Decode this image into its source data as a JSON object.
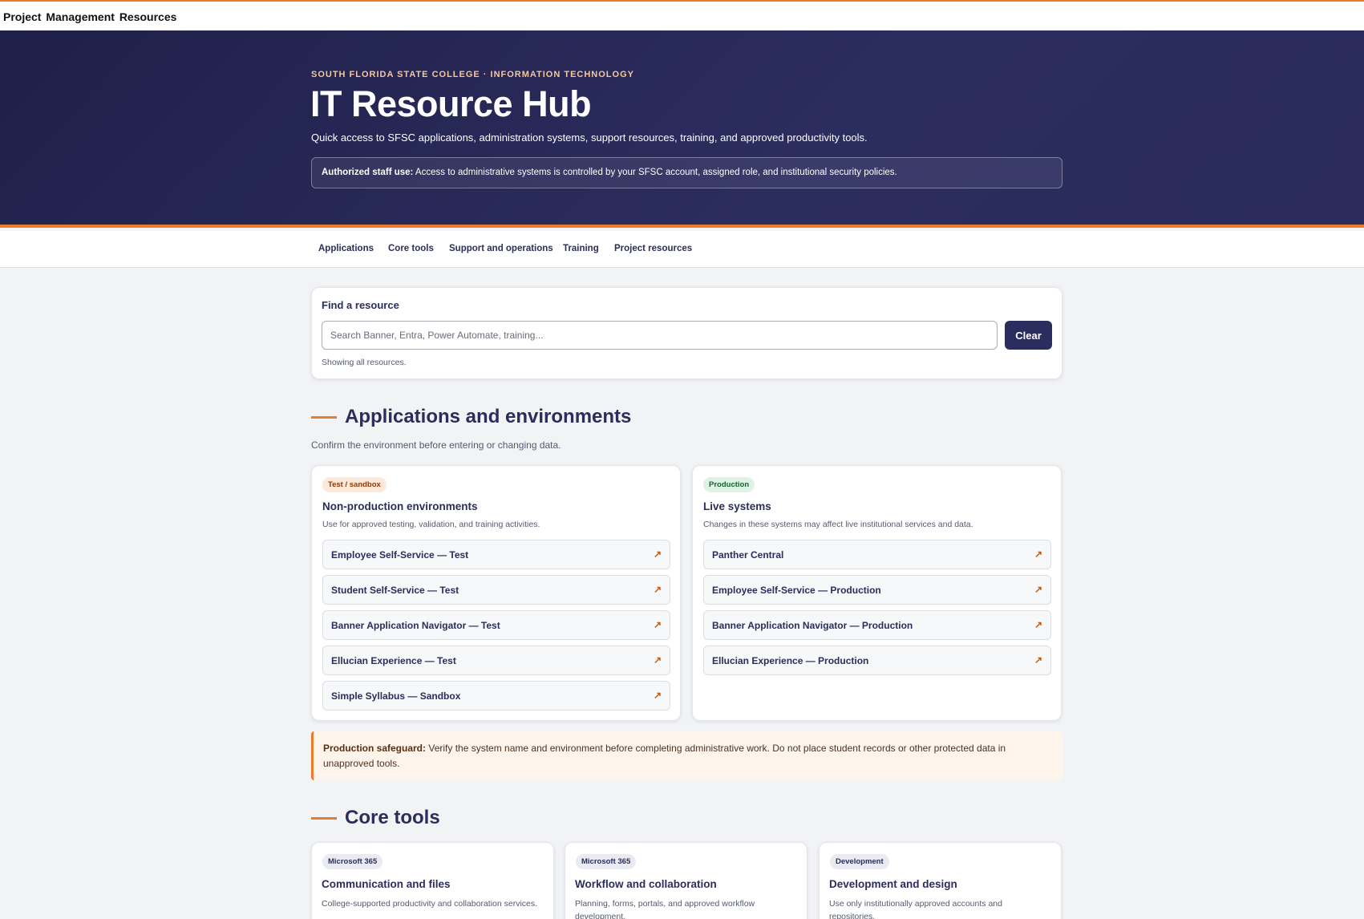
{
  "topbar": {
    "title": "Project Management Resources"
  },
  "hero": {
    "eyebrow": "SOUTH FLORIDA STATE COLLEGE · INFORMATION TECHNOLOGY",
    "title": "IT Resource Hub",
    "description": "Quick access to SFSC applications, administration systems, support resources, training, and approved productivity tools.",
    "notice_label": "Authorized staff use:",
    "notice_text": " Access to administrative systems is controlled by your SFSC account, assigned role, and institutional security policies."
  },
  "nav": {
    "items": [
      {
        "label": "Applications"
      },
      {
        "label": "Core tools"
      },
      {
        "label": "Support and operations"
      },
      {
        "label": "Training"
      },
      {
        "label": "Project resources"
      }
    ]
  },
  "search": {
    "label": "Find a resource",
    "placeholder": "Search Banner, Entra, Power Automate, training...",
    "value": "",
    "clear_label": "Clear",
    "status": "Showing all resources."
  },
  "applications": {
    "title": "Applications and environments",
    "subtitle": "Confirm the environment before entering or changing data.",
    "test_card": {
      "badge": "Test / sandbox",
      "title": "Non-production environments",
      "note": "Use for approved testing, validation, and training activities.",
      "links": [
        {
          "label": "Employee Self-Service — Test"
        },
        {
          "label": "Student Self-Service — Test"
        },
        {
          "label": "Banner Application Navigator — Test"
        },
        {
          "label": "Ellucian Experience — Test"
        },
        {
          "label": "Simple Syllabus — Sandbox"
        }
      ]
    },
    "prod_card": {
      "badge": "Production",
      "title": "Live systems",
      "note": "Changes in these systems may affect live institutional services and data.",
      "links": [
        {
          "label": "Panther Central"
        },
        {
          "label": "Employee Self-Service — Production"
        },
        {
          "label": "Banner Application Navigator — Production"
        },
        {
          "label": "Ellucian Experience — Production"
        }
      ]
    },
    "arrow_glyph": "↗",
    "safeguard_label": "Production safeguard:",
    "safeguard_text": " Verify the system name and environment before completing administrative work. Do not place student records or other protected data in unapproved tools."
  },
  "core_tools": {
    "title": "Core tools",
    "cards": [
      {
        "badge": "Microsoft 365",
        "title": "Communication and files",
        "note": "College-supported productivity and collaboration services."
      },
      {
        "badge": "Microsoft 365",
        "title": "Workflow and collaboration",
        "note": "Planning, forms, portals, and approved workflow development."
      },
      {
        "badge": "Development",
        "title": "Development and design",
        "note": "Use only institutionally approved accounts and repositories."
      }
    ]
  },
  "colors": {
    "accent": "#ed7a2c",
    "brand": "#2c2d5f"
  }
}
